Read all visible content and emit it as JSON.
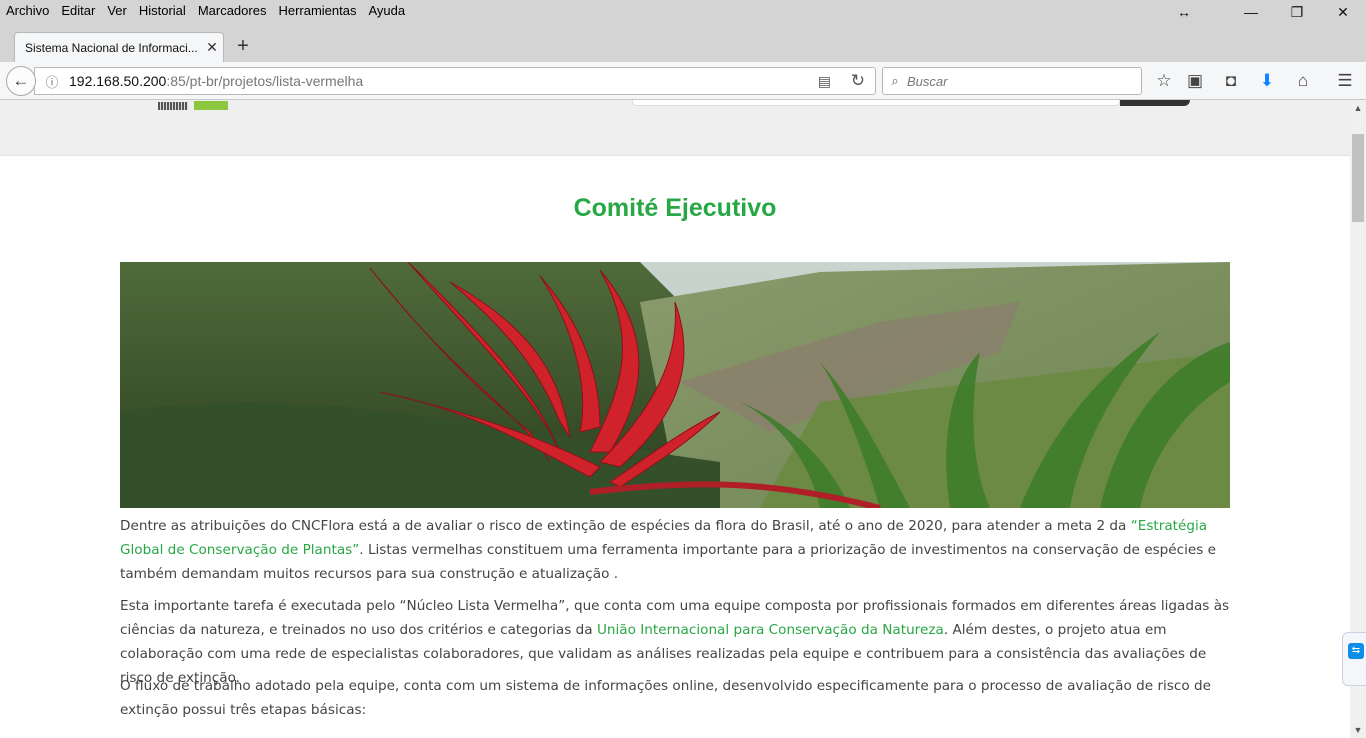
{
  "menubar": {
    "items": [
      "Archivo",
      "Editar",
      "Ver",
      "Historial",
      "Marcadores",
      "Herramientas",
      "Ayuda"
    ],
    "icons": {
      "resize": "resize-arrows-icon",
      "minimize": "minimize-icon",
      "restore": "restore-icon",
      "close": "close-icon"
    }
  },
  "tab": {
    "title": "Sistema Nacional de Informaci...",
    "close_glyph": "✕"
  },
  "newtab_glyph": "+",
  "navbar": {
    "url_host": "192.168.50.200",
    "url_path": ":85/pt-br/projetos/lista-vermelha",
    "search_placeholder": "Buscar"
  },
  "page": {
    "title": "Comité Ejecutivo",
    "paragraphs": [
      {
        "before": "Dentre as atribuições do CNCFlora está a de avaliar o risco de extinção de espécies da flora do Brasil, até o ano de 2020, para atender a meta 2 da ",
        "link": "“Estratégia Global de Conservação de Plantas”",
        "after": ". Listas vermelhas constituem uma ferramenta importante para a priorização de investimentos na conservação de espécies e também demandam muitos recursos para sua construção e atualização ."
      },
      {
        "before": "Esta importante tarefa é executada pelo “Núcleo Lista Vermelha”, que conta com uma equipe composta por profissionais formados em diferentes áreas ligadas às ciências da natureza, e treinados no uso dos critérios e categorias da ",
        "link": "União Internacional para Conservação da Natureza",
        "after": ". Além destes, o projeto atua em colaboração com uma rede de especialistas colaboradores, que validam as análises realizadas pela equipe e contribuem para a consistência das avaliações de risco de extinção."
      },
      {
        "before": "O fluxo de trabalho adotado pela equipe, conta com um sistema de informações online, desenvolvido especificamente para o processo de avaliação de risco de extinção possui três etapas básicas:",
        "link": "",
        "after": ""
      }
    ]
  },
  "colors": {
    "accent_green": "#28a745",
    "text": "#444444",
    "chrome": "#d4d4d4"
  }
}
